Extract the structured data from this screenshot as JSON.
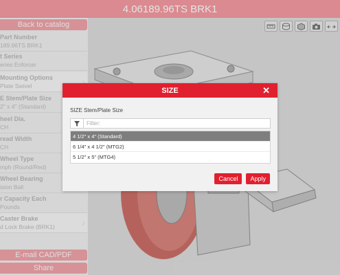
{
  "header": {
    "title": "4.06189.96TS BRK1"
  },
  "sidebar": {
    "back_label": "Back to catalog",
    "items": [
      {
        "label": "Part Number",
        "value": "189.96TS BRK1"
      },
      {
        "label": "t Series",
        "value": "eries Enforcer"
      },
      {
        "label": "Mounting Options",
        "value": "Plate Swivel"
      },
      {
        "label": "E Stem/Plate Size",
        "value": "2\" x 4\" (Standard)"
      },
      {
        "label": "heel Dia.",
        "value": "CH"
      },
      {
        "label": "read Width",
        "value": "CH"
      },
      {
        "label": "Wheel Type",
        "value": "mph (Round/Red)"
      },
      {
        "label": "Wheel Bearing",
        "value": "ision Ball"
      },
      {
        "label": "r Capacity Each",
        "value": " Pounds"
      },
      {
        "label": "Caster Brake",
        "value": "d Lock Brake (BRK1)"
      }
    ],
    "email_label": "E-mail CAD/PDF",
    "share_label": "Share"
  },
  "toolbar": {
    "icons": [
      "ruler-icon",
      "layers-icon",
      "cube-view-icon",
      "camera-icon",
      "explode-icon"
    ]
  },
  "modal": {
    "title": "SIZE",
    "close_glyph": "✕",
    "field_label": "SIZE Stem/Plate Size",
    "filter_placeholder": "Filter:",
    "filter_value": "",
    "options": [
      {
        "label": "4 1/2\" x 4\" (Standard)",
        "selected": true
      },
      {
        "label": "6 1/4\" x 4 1/2\" (MTG2)",
        "selected": false
      },
      {
        "label": "5 1/2\" x 5\" (MTG4)",
        "selected": false
      }
    ],
    "cancel_label": "Cancel",
    "apply_label": "Apply"
  },
  "colors": {
    "accent": "#e1202f",
    "accent_faded": "#f39aa1",
    "wheel": "#c85a52"
  }
}
